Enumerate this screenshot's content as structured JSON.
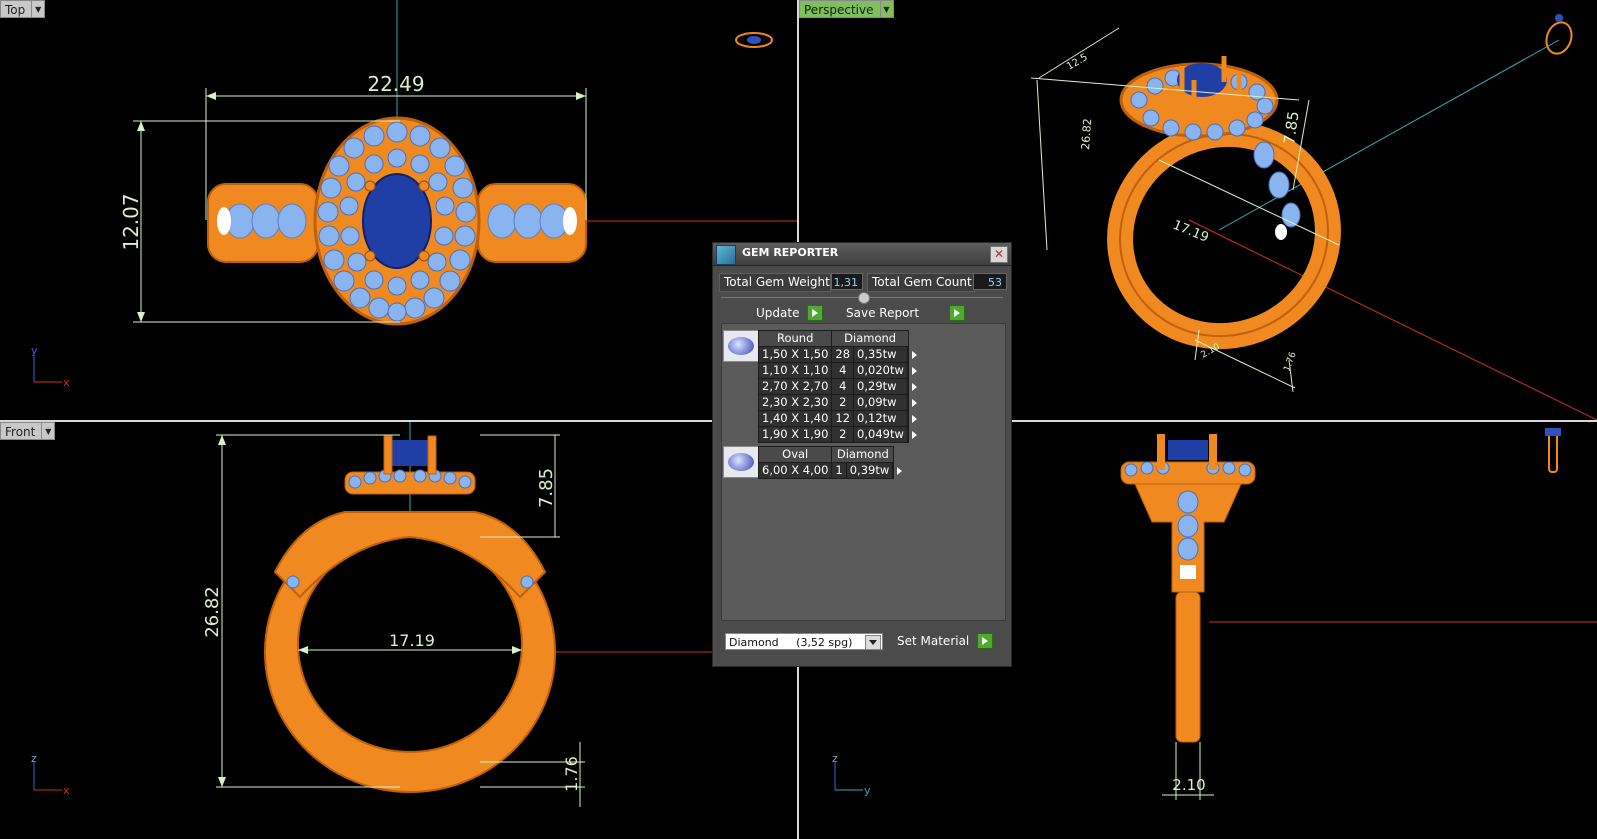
{
  "viewports": {
    "top": {
      "label": "Top",
      "dims": {
        "width": "22.49",
        "height": "12.07"
      },
      "axes": {
        "a": "y",
        "b": "x"
      }
    },
    "perspective": {
      "label": "Perspective",
      "dims": {
        "d1": "26.82",
        "d2": "7.85",
        "d3": "17.19",
        "d4": "12.5",
        "d5": "2.10",
        "d6": "1.76"
      }
    },
    "front": {
      "label": "Front",
      "dims": {
        "height": "26.82",
        "top": "7.85",
        "inner": "17.19",
        "bottom": "1.76"
      },
      "axes": {
        "a": "z",
        "b": "x"
      }
    },
    "right": {
      "dims": {
        "width": "2.10"
      },
      "axes": {
        "a": "z",
        "b": "y"
      }
    }
  },
  "gem_reporter": {
    "title": "GEM REPORTER",
    "total_weight_label": "Total Gem Weight",
    "total_weight_value": "1,31",
    "total_count_label": "Total Gem Count",
    "total_count_value": "53",
    "update_label": "Update",
    "save_report_label": "Save Report",
    "groups": [
      {
        "shape": "Round",
        "material": "Diamond",
        "rows": [
          {
            "size": "1,50 X 1,50",
            "count": "28",
            "weight": "0,35tw"
          },
          {
            "size": "1,10 X 1,10",
            "count": "4",
            "weight": "0,020tw"
          },
          {
            "size": "2,70 X 2,70",
            "count": "4",
            "weight": "0,29tw"
          },
          {
            "size": "2,30 X 2,30",
            "count": "2",
            "weight": "0,09tw"
          },
          {
            "size": "1,40 X 1,40",
            "count": "12",
            "weight": "0,12tw"
          },
          {
            "size": "1,90 X 1,90",
            "count": "2",
            "weight": "0,049tw"
          }
        ]
      },
      {
        "shape": "Oval",
        "material": "Diamond",
        "rows": [
          {
            "size": "6,00 X 4,00",
            "count": "1",
            "weight": "0,39tw"
          }
        ]
      }
    ],
    "material_select_value": "Diamond     (3,52 spg)",
    "set_material_label": "Set Material"
  },
  "colors": {
    "metal": "#f0891f",
    "metal_dark": "#c0600c",
    "gem_light": "#8ab4f0",
    "center_stone": "#1f3fa6",
    "dimension": "#d8f2c8",
    "axis_x": "#d03020",
    "axis_y": "#3aa8b8",
    "panel_accent": "#7fbf5e"
  }
}
